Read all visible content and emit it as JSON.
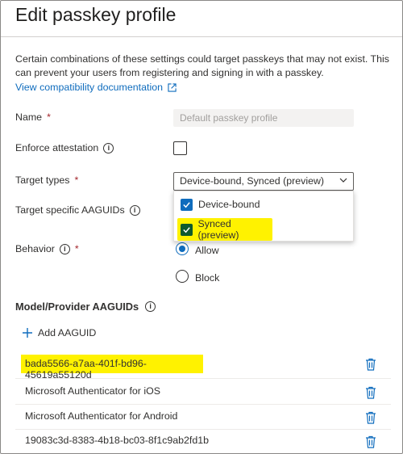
{
  "dialog": {
    "title": "Edit passkey profile",
    "info_text": "Certain combinations of these settings could target passkeys that may not exist. This can prevent your users from registering and signing in with a passkey.",
    "compat_link": "View compatibility documentation"
  },
  "fields": {
    "name_label": "Name",
    "name_placeholder": "Default passkey profile",
    "enforce_label": "Enforce attestation",
    "enforce_checked": false,
    "target_types_label": "Target types",
    "target_types_value": "Device-bound, Synced (preview)",
    "target_types_options": [
      {
        "label": "Device-bound",
        "checked": true
      },
      {
        "label": "Synced (preview)",
        "checked": true
      }
    ],
    "target_aaguids_label": "Target specific AAGUIDs",
    "behavior_label": "Behavior",
    "behavior_options": [
      {
        "label": "Allow",
        "selected": true
      },
      {
        "label": "Block",
        "selected": false
      }
    ],
    "required_mark": "*",
    "info_glyph": "i"
  },
  "aaguids": {
    "heading": "Model/Provider AAGUIDs",
    "add_label": "Add AAGUID",
    "items": [
      {
        "label": "bada5566-a7aa-401f-bd96-45619a55120d",
        "highlighted": true
      },
      {
        "label": "Microsoft Authenticator for iOS",
        "highlighted": false
      },
      {
        "label": "Microsoft Authenticator for Android",
        "highlighted": false
      },
      {
        "label": "19083c3d-8383-4b18-bc03-8f1c9ab2fd1b",
        "highlighted": false
      }
    ]
  },
  "colors": {
    "accent": "#0f6cbd",
    "highlight": "#fff200",
    "required": "#a4262c"
  }
}
